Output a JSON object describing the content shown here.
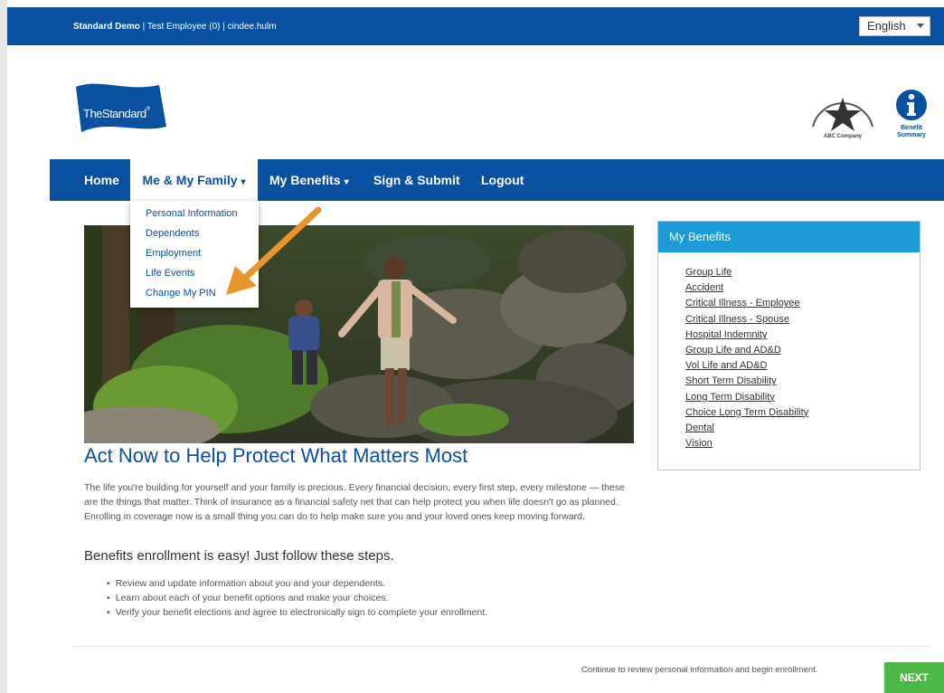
{
  "topbar": {
    "org": "Standard Demo",
    "user_info": " | Test Employee (0) | cindee.hulm",
    "language": "English"
  },
  "logo": {
    "text": "TheStandard",
    "mark": "®"
  },
  "company": {
    "name": "ABC Company"
  },
  "benefit_summary": {
    "line1": "Benefit",
    "line2": "Summary"
  },
  "nav": {
    "home": "Home",
    "me_family": "Me & My Family",
    "my_benefits": "My Benefits",
    "sign_submit": "Sign & Submit",
    "logout": "Logout"
  },
  "dropdown": {
    "items": [
      "Personal Information",
      "Dependents",
      "Employment",
      "Life Events",
      "Change My PIN"
    ]
  },
  "main": {
    "headline": "Act Now to Help Protect What Matters Most",
    "paragraph": "The life you're building for yourself and your family is precious. Every financial decision, every first step, every milestone — these are the things that matter. Think of insurance as a financial safety net that can help protect you when life doesn't go as planned. Enrolling in coverage now is a small thing you can do to help make sure you and your loved ones keep moving forward.",
    "subhead": "Benefits enrollment is easy! Just follow these steps.",
    "steps": [
      "Review and update information about you and your dependents.",
      "Learn about each of your benefit options and make your choices.",
      "Verify your benefit elections and agree to electronically sign to complete your enrollment."
    ]
  },
  "benefits_panel": {
    "title": "My Benefits",
    "links": [
      "Group Life",
      "Accident",
      "Critical Illness - Employee",
      "Critical Illness - Spouse",
      "Hospital Indemnity",
      "Group Life and AD&D",
      "Vol Life and AD&D",
      "Short Term Disability",
      "Long Term Disability",
      "Choice Long Term Disability",
      "Dental",
      "Vision"
    ]
  },
  "footer": {
    "continue_text": "Continue to review personal information and begin enrollment.",
    "next_label": "NEXT"
  },
  "colors": {
    "brand_blue": "#0a50a1",
    "panel_blue": "#1e9ad7",
    "next_green": "#4cb847",
    "arrow_orange": "#e8952f"
  },
  "icons": {
    "arrow": "orange-pointer-arrow",
    "star": "star-icon",
    "info": "info-icon"
  }
}
